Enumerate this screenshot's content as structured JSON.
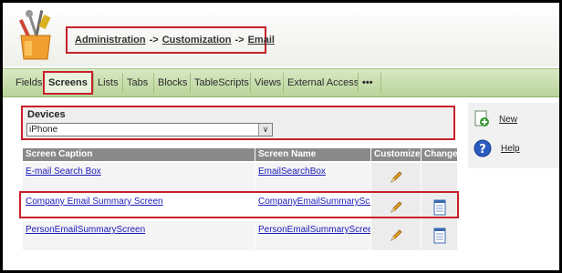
{
  "header": {
    "breadcrumb": [
      {
        "label": "Administration"
      },
      {
        "label": "Customization"
      },
      {
        "label": "Email"
      }
    ],
    "separator": "->"
  },
  "tabs": [
    {
      "label": "Fields"
    },
    {
      "label": "Screens",
      "active": true
    },
    {
      "label": "Lists"
    },
    {
      "label": "Tabs"
    },
    {
      "label": "Blocks"
    },
    {
      "label": "TableScripts"
    },
    {
      "label": "Views"
    },
    {
      "label": "External Access"
    },
    {
      "label": "•••"
    }
  ],
  "devices": {
    "label": "Devices",
    "selected": "iPhone",
    "arrow": "∨"
  },
  "table": {
    "columns": [
      "Screen Caption",
      "Screen Name",
      "Customize",
      "Change"
    ],
    "rows": [
      {
        "caption": "E-mail Search Box",
        "name": "EmailSearchBox",
        "customize_icon": "pencil-icon",
        "change_icon": ""
      },
      {
        "caption": "Company Email Summary Screen",
        "name": "CompanyEmailSummaryScreen",
        "customize_icon": "pencil-icon",
        "change_icon": "document-icon"
      },
      {
        "caption": "PersonEmailSummaryScreen",
        "name": "PersonEmailSummaryScreen",
        "customize_icon": "pencil-icon",
        "change_icon": "document-icon"
      }
    ]
  },
  "actions": {
    "new_label": "New",
    "help_label": "Help"
  },
  "colors": {
    "accent_red": "#c8202a",
    "tab_green": "#b8d49a",
    "link_blue": "#1a1ab8",
    "header_gray": "#8a8a8a"
  }
}
